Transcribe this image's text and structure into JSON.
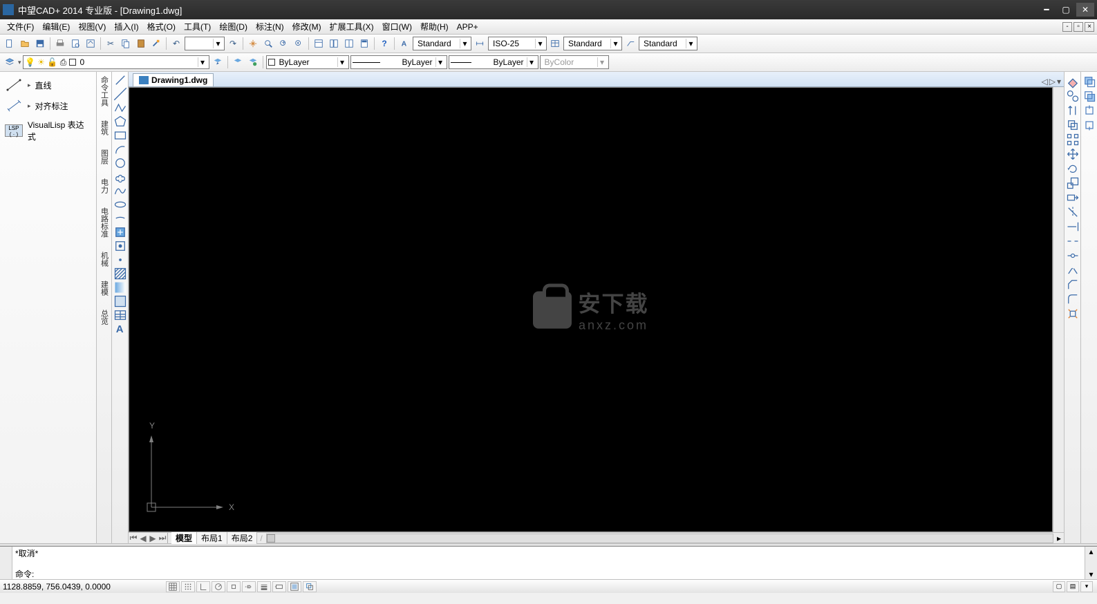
{
  "title": "中望CAD+ 2014 专业版 - [Drawing1.dwg]",
  "doc_tab": "Drawing1.dwg",
  "menu": {
    "file": "文件(F)",
    "edit": "编辑(E)",
    "view": "视图(V)",
    "insert": "插入(I)",
    "format": "格式(O)",
    "tools": "工具(T)",
    "draw": "绘图(D)",
    "dim": "标注(N)",
    "modify": "修改(M)",
    "ext": "扩展工具(X)",
    "window": "窗口(W)",
    "help": "帮助(H)",
    "app": "APP+"
  },
  "style_dd": {
    "text_style": "Standard",
    "dim_style": "ISO-25",
    "table_style": "Standard",
    "mleader_style": "Standard"
  },
  "layer_dd": {
    "layer": "0",
    "color": "ByLayer",
    "linetype": "ByLayer",
    "lineweight": "ByLayer",
    "plotstyle": "ByColor"
  },
  "palette": {
    "line": "直线",
    "alignDim": "对齐标注",
    "vlisp": "VisualLisp 表达式"
  },
  "side_tabs": {
    "t1": "命令工具",
    "t2": "建筑",
    "t3": "图层",
    "t4": "电力",
    "t5": "电路标准",
    "t6": "机械",
    "t7": "建模",
    "t8": "总览"
  },
  "layout_tabs": {
    "model": "模型",
    "l1": "布局1",
    "l2": "布局2"
  },
  "cmd": {
    "hist1": "*取消*",
    "prompt": "命令:"
  },
  "status": {
    "coords": "1128.8859, 756.0439, 0.0000"
  },
  "ucs": {
    "x": "X",
    "y": "Y"
  },
  "watermark": {
    "l1": "安下载",
    "l2": "anxz.com"
  }
}
